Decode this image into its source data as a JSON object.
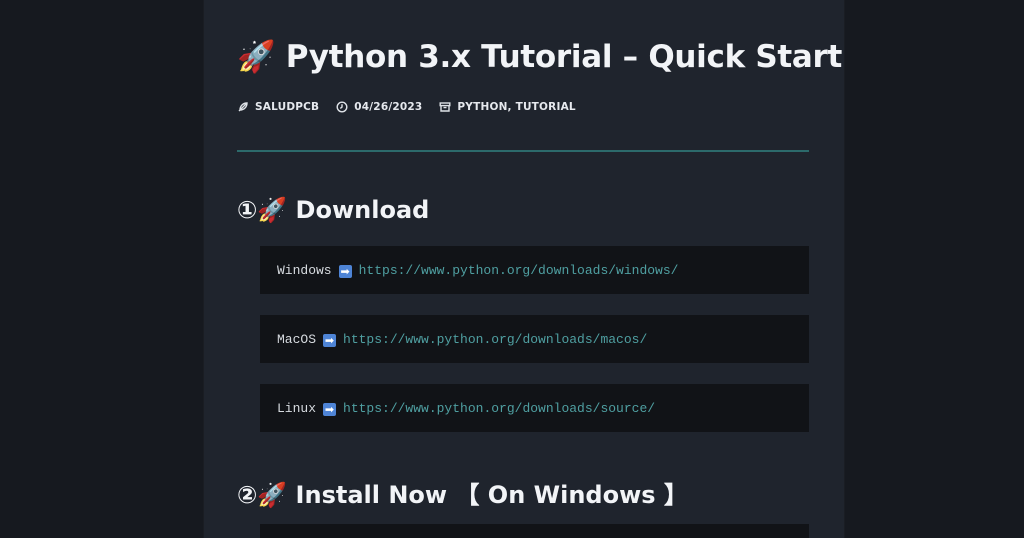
{
  "article": {
    "title": "🚀 Python 3.x Tutorial – Quick Start",
    "meta": {
      "author": "SALUDPCB",
      "date": "04/26/2023",
      "categories": "PYTHON, TUTORIAL",
      "icons": [
        "feather-icon",
        "clock-icon",
        "archive-icon"
      ]
    },
    "colors": {
      "background": "#16191f",
      "panel": "#1f242d",
      "code_bg": "#111317",
      "divider": "#2c6a6b",
      "link": "#4f9fa1"
    },
    "sections": [
      {
        "heading": "①🚀 Download",
        "downloads": [
          {
            "os": "Windows",
            "arrow": "➡",
            "url": "https://www.python.org/downloads/windows/"
          },
          {
            "os": "MacOS",
            "arrow": "➡",
            "url": "https://www.python.org/downloads/macos/"
          },
          {
            "os": "Linux",
            "arrow": "➡",
            "url": "https://www.python.org/downloads/source/"
          }
        ]
      },
      {
        "heading": "②🚀 Install Now 【 On Windows 】"
      }
    ]
  }
}
